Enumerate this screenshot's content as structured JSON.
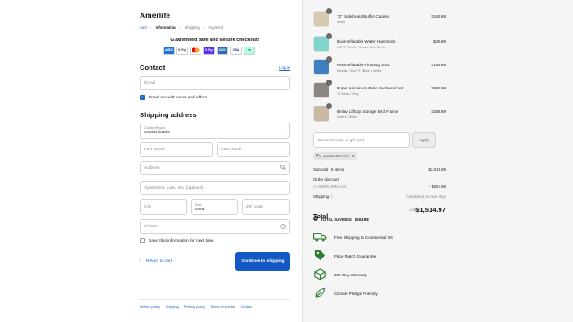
{
  "brand": "Amerlife",
  "breadcrumb": [
    "Cart",
    "Information",
    "Shipping",
    "Payment"
  ],
  "guarantee": "Guaranteed safe and secure checkout!",
  "payment_icons": [
    "AMEX",
    "G Pay",
    "MC",
    "S Pay",
    "DISC",
    "VISA",
    "Afterpay"
  ],
  "contact": {
    "title": "Contact",
    "login_label": "Log in",
    "email_placeholder": "Email",
    "news_label": "Email me with news and offers",
    "news_checked": true
  },
  "shipping": {
    "title": "Shipping address",
    "country_label": "Country/Region",
    "country_value": "United States",
    "first_name_placeholder": "First name",
    "last_name_placeholder": "Last name",
    "address_placeholder": "Address",
    "apartment_placeholder": "Apartment, suite, etc. (optional)",
    "city_placeholder": "City",
    "state_label": "State",
    "state_value": "Iowa",
    "zip_placeholder": "ZIP code",
    "phone_placeholder": "Phone",
    "save_label": "Save this information for next time"
  },
  "actions": {
    "return_label": "Return to cart",
    "continue_label": "Continue to shipping"
  },
  "footer_links": [
    "Refund policy",
    "Shipping",
    "Privacy policy",
    "Terms of service",
    "Contact"
  ],
  "cart": {
    "items": [
      {
        "qty": "1",
        "name": "72\" Sideboard Buffet Cabinet",
        "variant": "White",
        "price": "$349.99",
        "color": "#d9c9b0"
      },
      {
        "qty": "1",
        "name": "Nixie Inflatable Water Hammock",
        "variant": "6.6FT / Circle / Yellow+Mint Green",
        "price": "$49.99",
        "color": "#7fd4cc"
      },
      {
        "qty": "1",
        "name": "Pexv Inflatable Floating Dock",
        "variant": "Regular / 6x6 FT / Blue & White",
        "price": "$159.99",
        "color": "#3f7fbf"
      },
      {
        "qty": "1",
        "name": "Roper Aluminum Patio Sectional Set",
        "variant": "13 Seats / Grey",
        "price": "$969.99",
        "color": "#8a8580"
      },
      {
        "qty": "1",
        "name": "Binley Lift Up Storage Bed Frame",
        "variant": "Queen / White",
        "price": "$289.99",
        "color": "#c9b8a5"
      }
    ],
    "discount_placeholder": "Discount code or gift card",
    "apply_label": "Apply",
    "applied_code": "AMERLIFECA25",
    "subtotal_label": "Subtotal · 5 items",
    "subtotal_value": "$2,019.95",
    "order_discount_label": "Order discount",
    "discount_code": "AMERLIFECA25",
    "discount_value": "− $504.98",
    "shipping_label": "Shipping",
    "shipping_value": "Calculated at next step",
    "total_label": "Total",
    "currency": "USD",
    "total_value": "$1,514.97",
    "savings_label": "TOTAL SAVINGS",
    "savings_value": "$504.98"
  },
  "perks": [
    {
      "icon": "truck-icon",
      "label": "Free Shipping to Continental US"
    },
    {
      "icon": "price-tag-icon",
      "label": "Price Match Guarantee"
    },
    {
      "icon": "box-return-icon",
      "label": "365-Day Warranty"
    },
    {
      "icon": "leaf-icon",
      "label": "Climate Pledge Friendly"
    }
  ],
  "colors": {
    "accent": "#1458c4",
    "link": "#1a64c8",
    "perk_green": "#2e7d32"
  }
}
